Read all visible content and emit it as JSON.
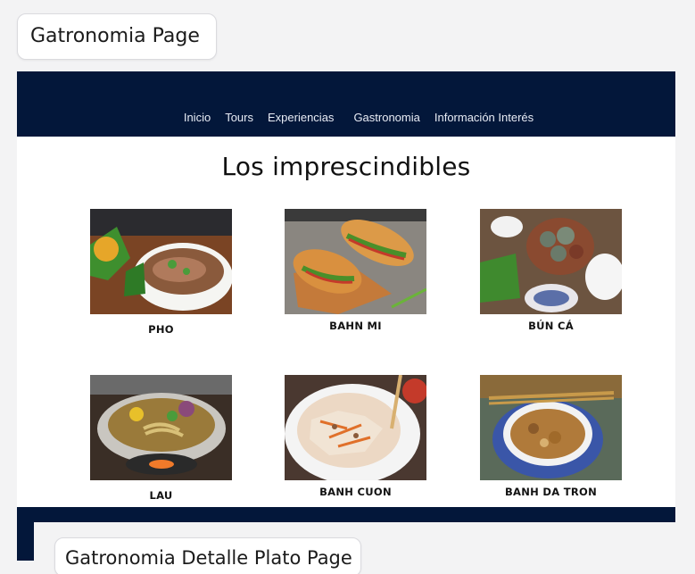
{
  "screens": {
    "top_label": "Gatronomia Page",
    "bottom_label": "Gatronomia Detalle Plato Page"
  },
  "nav": {
    "items": [
      "Inicio",
      "Tours",
      "Experiencias",
      "Gastronomia",
      "Información Interés"
    ]
  },
  "main": {
    "title": "Los imprescindibles",
    "dishes": [
      {
        "name": "PHO"
      },
      {
        "name": "BAHN MI"
      },
      {
        "name": "BÚN CÁ"
      },
      {
        "name": "LAU"
      },
      {
        "name": "BANH CUON"
      },
      {
        "name": "BANH DA TRON"
      }
    ]
  },
  "colors": {
    "navbar": "#03173a",
    "page_bg": "#f3f3f4",
    "card_bg": "#ffffff"
  }
}
